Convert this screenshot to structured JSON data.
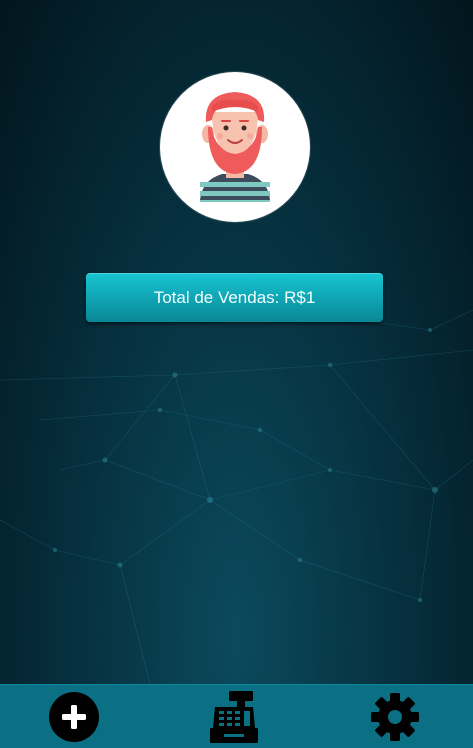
{
  "profile": {
    "avatar_icon": "bearded-man-avatar"
  },
  "sales": {
    "total_label": "Total de Vendas: R$1"
  },
  "bottom_nav": {
    "items": [
      {
        "icon": "plus-circle-icon"
      },
      {
        "icon": "cash-register-icon"
      },
      {
        "icon": "gear-icon"
      }
    ]
  },
  "colors": {
    "background_dark": "#02151d",
    "background_teal": "#0b4a5c",
    "button_accent": "#10a9b8",
    "bottom_bar": "#0b7084",
    "icon_dark": "#000000"
  }
}
